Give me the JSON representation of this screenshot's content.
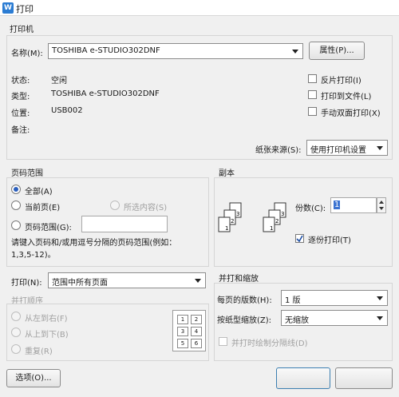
{
  "window": {
    "title": "打印",
    "icon": "wps-writer-icon"
  },
  "printer": {
    "section_title": "打印机",
    "name_label": "名称(M):",
    "name_value": "TOSHIBA e-STUDIO302DNF",
    "properties_button": "属性(P)...",
    "status_label": "状态:",
    "status_value": "空闲",
    "type_label": "类型:",
    "type_value": "TOSHIBA e-STUDIO302DNF",
    "location_label": "位置:",
    "location_value": "USB002",
    "comment_label": "备注:",
    "comment_value": "",
    "reverse_print": "反片打印(I)",
    "print_to_file": "打印到文件(L)",
    "manual_duplex": "手动双面打印(X)",
    "paper_source_label": "纸张来源(S):",
    "paper_source_value": "使用打印机设置"
  },
  "page_range": {
    "title": "页码范围",
    "all": "全部(A)",
    "current": "当前页(E)",
    "selection": "所选内容(S)",
    "range": "页码范围(G):",
    "range_value": "",
    "hint": "请键入页码和/或用逗号分隔的页码范围(例如：1,3,5-12)。",
    "selected": "all"
  },
  "copies": {
    "title": "副本",
    "count_label": "份数(C):",
    "count_value": "1",
    "collate": "逐份打印(T)",
    "collate_checked": true
  },
  "print_what": {
    "label": "打印(N):",
    "value": "范围中所有页面"
  },
  "print_order": {
    "title": "并打顺序",
    "left_to_right": "从左到右(F)",
    "top_to_bottom": "从上到下(B)",
    "repeat": "重复(R)",
    "preview": [
      "1",
      "2",
      "3",
      "4",
      "5",
      "6"
    ]
  },
  "zoom": {
    "title": "并打和缩放",
    "pages_per_sheet_label": "每页的版数(H):",
    "pages_per_sheet_value": "1 版",
    "scale_label": "按纸型缩放(Z):",
    "scale_value": "无缩放",
    "draw_lines": "并打时绘制分隔线(D)"
  },
  "footer": {
    "options_button": "选项(O)..."
  }
}
